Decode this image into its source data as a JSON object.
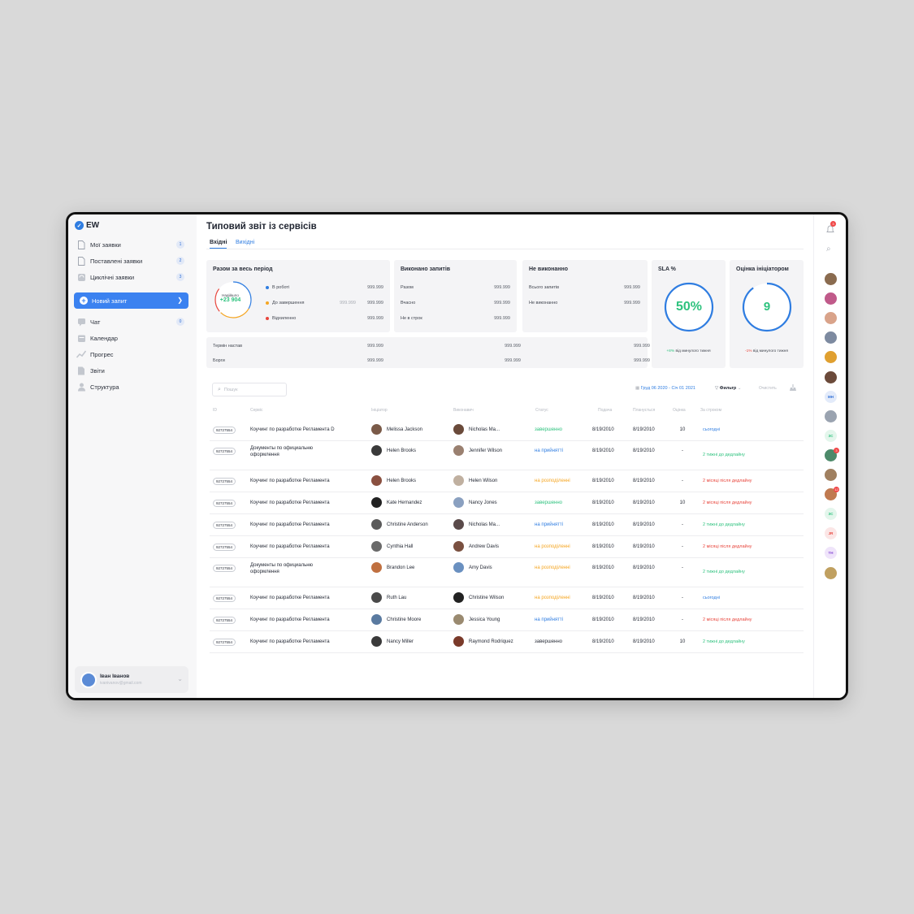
{
  "app": {
    "logo": "EW",
    "title": "Типовий звіт із сервісів"
  },
  "colors": {
    "accent": "#2f7de1",
    "green": "#2ec27e",
    "orange": "#f5a623",
    "red": "#e8453c",
    "blue": "#2f7de1"
  },
  "sidebar": {
    "items": [
      {
        "label": "Мої заявки",
        "count": "1",
        "icon": "doc-icon"
      },
      {
        "label": "Поставлені заявки",
        "count": "2",
        "icon": "doc-icon"
      },
      {
        "label": "Циклічні заявки",
        "count": "3",
        "icon": "cycle-icon"
      }
    ],
    "new_request": "Новий запит",
    "items2": [
      {
        "label": "Чат",
        "count": "0",
        "icon": "chat-icon"
      },
      {
        "label": "Календар",
        "icon": "calendar-icon"
      },
      {
        "label": "Прогрес",
        "icon": "progress-icon"
      },
      {
        "label": "Звіти",
        "icon": "reports-icon"
      },
      {
        "label": "Структура",
        "icon": "structure-icon"
      }
    ],
    "user": {
      "name": "Іван Іванов",
      "email": "ivanivanov@gmail.com"
    }
  },
  "tabs": [
    "Вхідні",
    "Вихідні"
  ],
  "cards": {
    "total": {
      "title": "Разом за весь період",
      "ring_label": "Надійшло",
      "ring_value": "+23 904",
      "rows": [
        {
          "label": "В роботі",
          "color": "#2f7de1",
          "value": "999.999",
          "value2": ""
        },
        {
          "label": "До завершення",
          "color": "#f5a623",
          "value": "999.999",
          "value2": "999.999"
        },
        {
          "label": "Відхиленно",
          "color": "#e8453c",
          "value": "999.999",
          "value2": ""
        }
      ]
    },
    "done": {
      "title": "Виконано запитів",
      "rows": [
        {
          "label": "Разом",
          "value": "999.999"
        },
        {
          "label": "Вчасно",
          "value": "999.999"
        },
        {
          "label": "Не в строк",
          "value": "999.999"
        }
      ]
    },
    "notdone": {
      "title": "Не виконанно",
      "rows": [
        {
          "label": "Всього запитів",
          "value": "999.999"
        },
        {
          "label": "Не виконанно",
          "value": "999.999"
        }
      ]
    },
    "sla": {
      "title": "SLA %",
      "value": "50%",
      "fraction": 0.5,
      "delta": "+8%",
      "delta_text": "від минулого тижня"
    },
    "rating": {
      "title": "Оцінка ініціатором",
      "value": "9",
      "fraction": 0.9,
      "delta": "-1%",
      "delta_text": "від минулого тижня"
    },
    "bottom": [
      {
        "label": "Термін настав",
        "v1": "999.999",
        "v2": "999.999",
        "v3": "999.999"
      },
      {
        "label": "Борги",
        "v1": "999.999",
        "v2": "999.999",
        "v3": "999.999"
      }
    ]
  },
  "toolbar": {
    "search_placeholder": "Пошук",
    "date_range": "Груд 06 2020 - Січ 01 2021",
    "filter": "Фильтр",
    "clear": "Очистить"
  },
  "table": {
    "headers": [
      "ID",
      "Сервіс",
      "Ініціатор",
      "Виконавич",
      "Статус",
      "Подача",
      "Планується",
      "Оцінка",
      "За строком"
    ],
    "rows": [
      {
        "id": "92727554",
        "service": "Коучинг по разработке Регламента D",
        "service2": "",
        "init": "Melissa Jackson",
        "exec": "Nicholas Ma...",
        "status": "завершенно",
        "statusColor": "#2ec27e",
        "submit": "8/19/2010",
        "plan": "8/19/2010",
        "score": "10",
        "term": "сьогодні",
        "termColor": "#2f7de1"
      },
      {
        "id": "92727554",
        "service": "Документы по официальню",
        "service2": "оформлення",
        "init": "Helen Brooks",
        "exec": "Jennifer Wilson",
        "status": "на прийнятті",
        "statusColor": "#2f7de1",
        "submit": "8/19/2010",
        "plan": "8/19/2010",
        "score": "-",
        "term": "2 тижні до дедлайну",
        "termColor": "#2ec27e"
      },
      {
        "id": "92727554",
        "service": "Коучинг по разработке Регламента",
        "service2": "",
        "init": "Helen Brooks",
        "exec": "Helen Wilson",
        "status": "на розподіленні",
        "statusColor": "#f5a623",
        "submit": "8/19/2010",
        "plan": "8/19/2010",
        "score": "-",
        "term": "2 місяці після дедлайну",
        "termColor": "#e8453c"
      },
      {
        "id": "92727554",
        "service": "Коучинг по разработке Регламента",
        "service2": "",
        "init": "Kate Hernandez",
        "exec": "Nancy Jones",
        "status": "завершенно",
        "statusColor": "#2ec27e",
        "submit": "8/19/2010",
        "plan": "8/19/2010",
        "score": "10",
        "term": "2 місяці після дедлайну",
        "termColor": "#e8453c"
      },
      {
        "id": "92727554",
        "service": "Коучинг по разработке Регламента",
        "service2": "",
        "init": "Christine Anderson",
        "exec": "Nicholas Ma...",
        "status": "на прийнятті",
        "statusColor": "#2f7de1",
        "submit": "8/19/2010",
        "plan": "8/19/2010",
        "score": "-",
        "term": "2 тижні до дедлайну",
        "termColor": "#2ec27e"
      },
      {
        "id": "92727554",
        "service": "Коучинг по разработке Регламента",
        "service2": "",
        "init": "Cynthia Hall",
        "exec": "Andrew Davis",
        "status": "на розподіленні",
        "statusColor": "#f5a623",
        "submit": "8/19/2010",
        "plan": "8/19/2010",
        "score": "-",
        "term": "2 місяці після дедлайну",
        "termColor": "#e8453c"
      },
      {
        "id": "92727554",
        "service": "Документы по официальню",
        "service2": "оформлення",
        "init": "Brandon Lee",
        "exec": "Amy Davis",
        "status": "на розподіленні",
        "statusColor": "#f5a623",
        "submit": "8/19/2010",
        "plan": "8/19/2010",
        "score": "-",
        "term": "2 тижні до дедлайну",
        "termColor": "#2ec27e"
      },
      {
        "id": "92727554",
        "service": "Коучинг по разработке Регламента",
        "service2": "",
        "init": "Ruth Lau",
        "exec": "Christine Wilson",
        "status": "на розподіленні",
        "statusColor": "#f5a623",
        "submit": "8/19/2010",
        "plan": "8/19/2010",
        "score": "-",
        "term": "сьогодні",
        "termColor": "#2f7de1"
      },
      {
        "id": "92727554",
        "service": "Коучинг по разработке Регламента",
        "service2": "",
        "init": "Christine Moore",
        "exec": "Jessica Young",
        "status": "на прийнятті",
        "statusColor": "#2f7de1",
        "submit": "8/19/2010",
        "plan": "8/19/2010",
        "score": "-",
        "term": "2 місяці після дедлайну",
        "termColor": "#e8453c"
      },
      {
        "id": "92727554",
        "service": "Коучинг по разработке Регламента",
        "service2": "",
        "init": "Nancy Miller",
        "exec": "Raymond Rodriquez",
        "status": "завершенно",
        "statusColor": "#2a2f3a",
        "submit": "8/19/2010",
        "plan": "8/19/2010",
        "score": "10",
        "term": "2 тижні до дедлайну",
        "termColor": "#2ec27e"
      }
    ]
  },
  "rail": {
    "notifications": "3",
    "avatars": [
      {
        "initials": "",
        "color": "#8a6b4f",
        "badge": ""
      },
      {
        "initials": "",
        "color": "#c05a8a",
        "badge": ""
      },
      {
        "initials": "",
        "color": "#d9a38a",
        "badge": ""
      },
      {
        "initials": "",
        "color": "#7d8aa0",
        "badge": ""
      },
      {
        "initials": "",
        "color": "#e0a030",
        "badge": ""
      },
      {
        "initials": "",
        "color": "#6b4a3a",
        "badge": ""
      },
      {
        "initials": "MH",
        "color": "#e3ebfa",
        "text": "#2f6fd6",
        "badge": ""
      },
      {
        "initials": "",
        "color": "#9aa3b0",
        "badge": ""
      },
      {
        "initials": "ЗС",
        "color": "#e4f6ec",
        "text": "#2ec27e",
        "badge": ""
      },
      {
        "initials": "",
        "color": "#4d8a6a",
        "badge": "3"
      },
      {
        "initials": "",
        "color": "#a08060",
        "badge": ""
      },
      {
        "initials": "",
        "color": "#c07a50",
        "badge": "12"
      },
      {
        "initials": "ЗС",
        "color": "#e4f6ec",
        "text": "#2ec27e",
        "badge": ""
      },
      {
        "initials": "JR",
        "color": "#fbe6e6",
        "text": "#e8453c",
        "badge": ""
      },
      {
        "initials": "TH",
        "color": "#efe4fa",
        "text": "#8a4fd6",
        "badge": ""
      },
      {
        "initials": "",
        "color": "#c0a060",
        "badge": ""
      }
    ]
  }
}
